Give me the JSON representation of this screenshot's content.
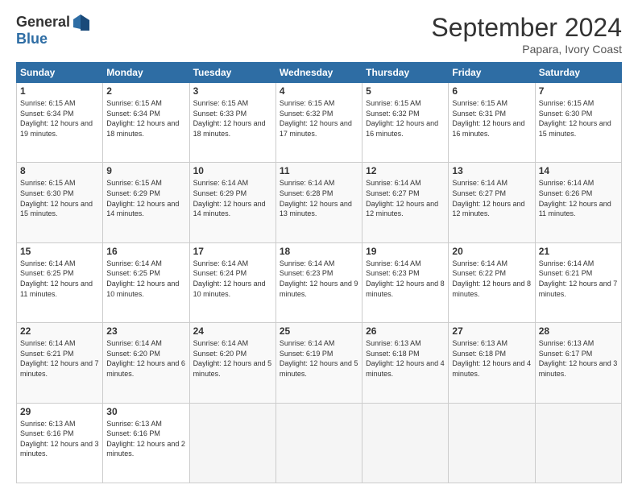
{
  "logo": {
    "general": "General",
    "blue": "Blue"
  },
  "title": "September 2024",
  "location": "Papara, Ivory Coast",
  "days_header": [
    "Sunday",
    "Monday",
    "Tuesday",
    "Wednesday",
    "Thursday",
    "Friday",
    "Saturday"
  ],
  "weeks": [
    [
      {
        "day": "1",
        "sunrise": "6:15 AM",
        "sunset": "6:34 PM",
        "daylight": "12 hours and 19 minutes."
      },
      {
        "day": "2",
        "sunrise": "6:15 AM",
        "sunset": "6:34 PM",
        "daylight": "12 hours and 18 minutes."
      },
      {
        "day": "3",
        "sunrise": "6:15 AM",
        "sunset": "6:33 PM",
        "daylight": "12 hours and 18 minutes."
      },
      {
        "day": "4",
        "sunrise": "6:15 AM",
        "sunset": "6:32 PM",
        "daylight": "12 hours and 17 minutes."
      },
      {
        "day": "5",
        "sunrise": "6:15 AM",
        "sunset": "6:32 PM",
        "daylight": "12 hours and 16 minutes."
      },
      {
        "day": "6",
        "sunrise": "6:15 AM",
        "sunset": "6:31 PM",
        "daylight": "12 hours and 16 minutes."
      },
      {
        "day": "7",
        "sunrise": "6:15 AM",
        "sunset": "6:30 PM",
        "daylight": "12 hours and 15 minutes."
      }
    ],
    [
      {
        "day": "8",
        "sunrise": "6:15 AM",
        "sunset": "6:30 PM",
        "daylight": "12 hours and 15 minutes."
      },
      {
        "day": "9",
        "sunrise": "6:15 AM",
        "sunset": "6:29 PM",
        "daylight": "12 hours and 14 minutes."
      },
      {
        "day": "10",
        "sunrise": "6:14 AM",
        "sunset": "6:29 PM",
        "daylight": "12 hours and 14 minutes."
      },
      {
        "day": "11",
        "sunrise": "6:14 AM",
        "sunset": "6:28 PM",
        "daylight": "12 hours and 13 minutes."
      },
      {
        "day": "12",
        "sunrise": "6:14 AM",
        "sunset": "6:27 PM",
        "daylight": "12 hours and 12 minutes."
      },
      {
        "day": "13",
        "sunrise": "6:14 AM",
        "sunset": "6:27 PM",
        "daylight": "12 hours and 12 minutes."
      },
      {
        "day": "14",
        "sunrise": "6:14 AM",
        "sunset": "6:26 PM",
        "daylight": "12 hours and 11 minutes."
      }
    ],
    [
      {
        "day": "15",
        "sunrise": "6:14 AM",
        "sunset": "6:25 PM",
        "daylight": "12 hours and 11 minutes."
      },
      {
        "day": "16",
        "sunrise": "6:14 AM",
        "sunset": "6:25 PM",
        "daylight": "12 hours and 10 minutes."
      },
      {
        "day": "17",
        "sunrise": "6:14 AM",
        "sunset": "6:24 PM",
        "daylight": "12 hours and 10 minutes."
      },
      {
        "day": "18",
        "sunrise": "6:14 AM",
        "sunset": "6:23 PM",
        "daylight": "12 hours and 9 minutes."
      },
      {
        "day": "19",
        "sunrise": "6:14 AM",
        "sunset": "6:23 PM",
        "daylight": "12 hours and 8 minutes."
      },
      {
        "day": "20",
        "sunrise": "6:14 AM",
        "sunset": "6:22 PM",
        "daylight": "12 hours and 8 minutes."
      },
      {
        "day": "21",
        "sunrise": "6:14 AM",
        "sunset": "6:21 PM",
        "daylight": "12 hours and 7 minutes."
      }
    ],
    [
      {
        "day": "22",
        "sunrise": "6:14 AM",
        "sunset": "6:21 PM",
        "daylight": "12 hours and 7 minutes."
      },
      {
        "day": "23",
        "sunrise": "6:14 AM",
        "sunset": "6:20 PM",
        "daylight": "12 hours and 6 minutes."
      },
      {
        "day": "24",
        "sunrise": "6:14 AM",
        "sunset": "6:20 PM",
        "daylight": "12 hours and 5 minutes."
      },
      {
        "day": "25",
        "sunrise": "6:14 AM",
        "sunset": "6:19 PM",
        "daylight": "12 hours and 5 minutes."
      },
      {
        "day": "26",
        "sunrise": "6:13 AM",
        "sunset": "6:18 PM",
        "daylight": "12 hours and 4 minutes."
      },
      {
        "day": "27",
        "sunrise": "6:13 AM",
        "sunset": "6:18 PM",
        "daylight": "12 hours and 4 minutes."
      },
      {
        "day": "28",
        "sunrise": "6:13 AM",
        "sunset": "6:17 PM",
        "daylight": "12 hours and 3 minutes."
      }
    ],
    [
      {
        "day": "29",
        "sunrise": "6:13 AM",
        "sunset": "6:16 PM",
        "daylight": "12 hours and 3 minutes."
      },
      {
        "day": "30",
        "sunrise": "6:13 AM",
        "sunset": "6:16 PM",
        "daylight": "12 hours and 2 minutes."
      },
      null,
      null,
      null,
      null,
      null
    ]
  ]
}
